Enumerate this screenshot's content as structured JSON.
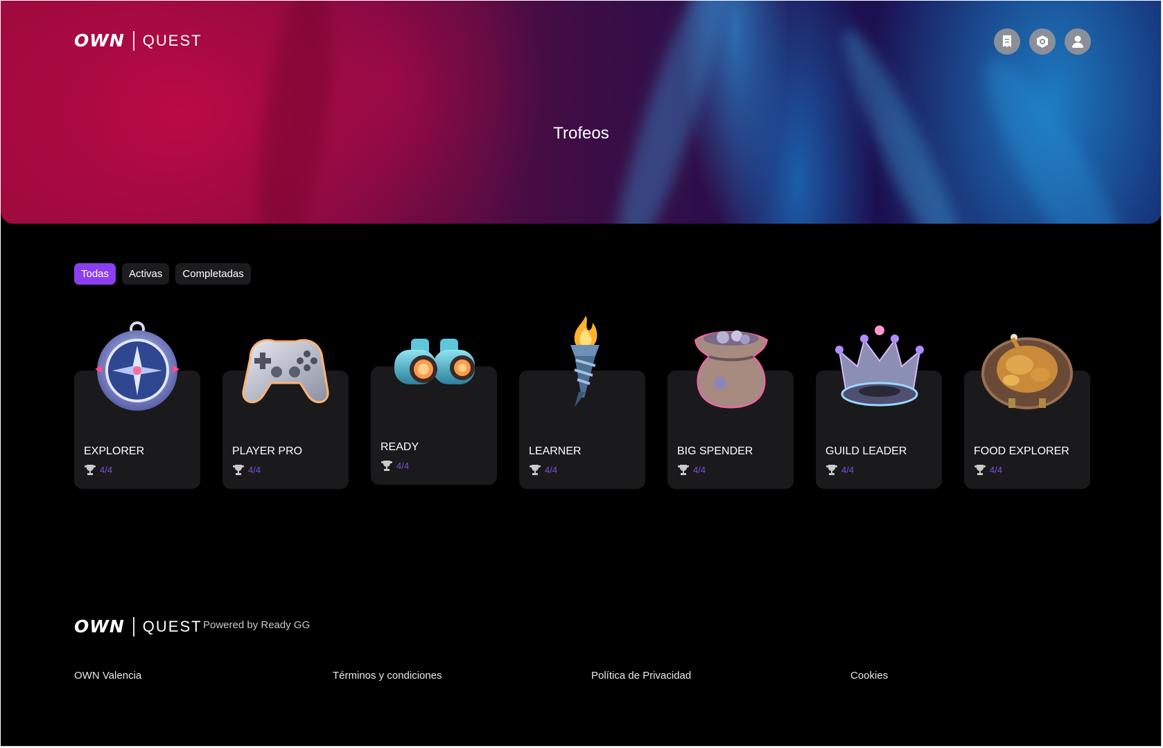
{
  "brand": {
    "own": "OWN",
    "quest": "QUEST"
  },
  "header": {
    "buttons": [
      {
        "icon": "receipt-icon"
      },
      {
        "icon": "coin-icon"
      },
      {
        "icon": "user-icon"
      }
    ]
  },
  "hero": {
    "title": "Trofeos"
  },
  "filters": [
    {
      "label": "Todas",
      "active": true
    },
    {
      "label": "Activas",
      "active": false
    },
    {
      "label": "Completadas",
      "active": false
    }
  ],
  "trophies": [
    {
      "name": "EXPLORER",
      "progress": "4/4",
      "icon": "compass-icon"
    },
    {
      "name": "PLAYER PRO",
      "progress": "4/4",
      "icon": "gamepad-icon"
    },
    {
      "name": "READY",
      "progress": "4/4",
      "icon": "binoculars-icon"
    },
    {
      "name": "LEARNER",
      "progress": "4/4",
      "icon": "torch-icon"
    },
    {
      "name": "BIG SPENDER",
      "progress": "4/4",
      "icon": "money-bag-icon"
    },
    {
      "name": "GUILD LEADER",
      "progress": "4/4",
      "icon": "crown-icon"
    },
    {
      "name": "FOOD EXPLORER",
      "progress": "4/4",
      "icon": "roast-chicken-icon"
    }
  ],
  "footer": {
    "powered_by": "Powered by Ready GG",
    "links": [
      "OWN Valencia",
      "Términos y condiciones",
      "Política de Privacidad",
      "Cookies"
    ]
  },
  "colors": {
    "accent": "#8b3ff0",
    "progress": "#7b4fe0",
    "card": "#1a1a1c"
  }
}
